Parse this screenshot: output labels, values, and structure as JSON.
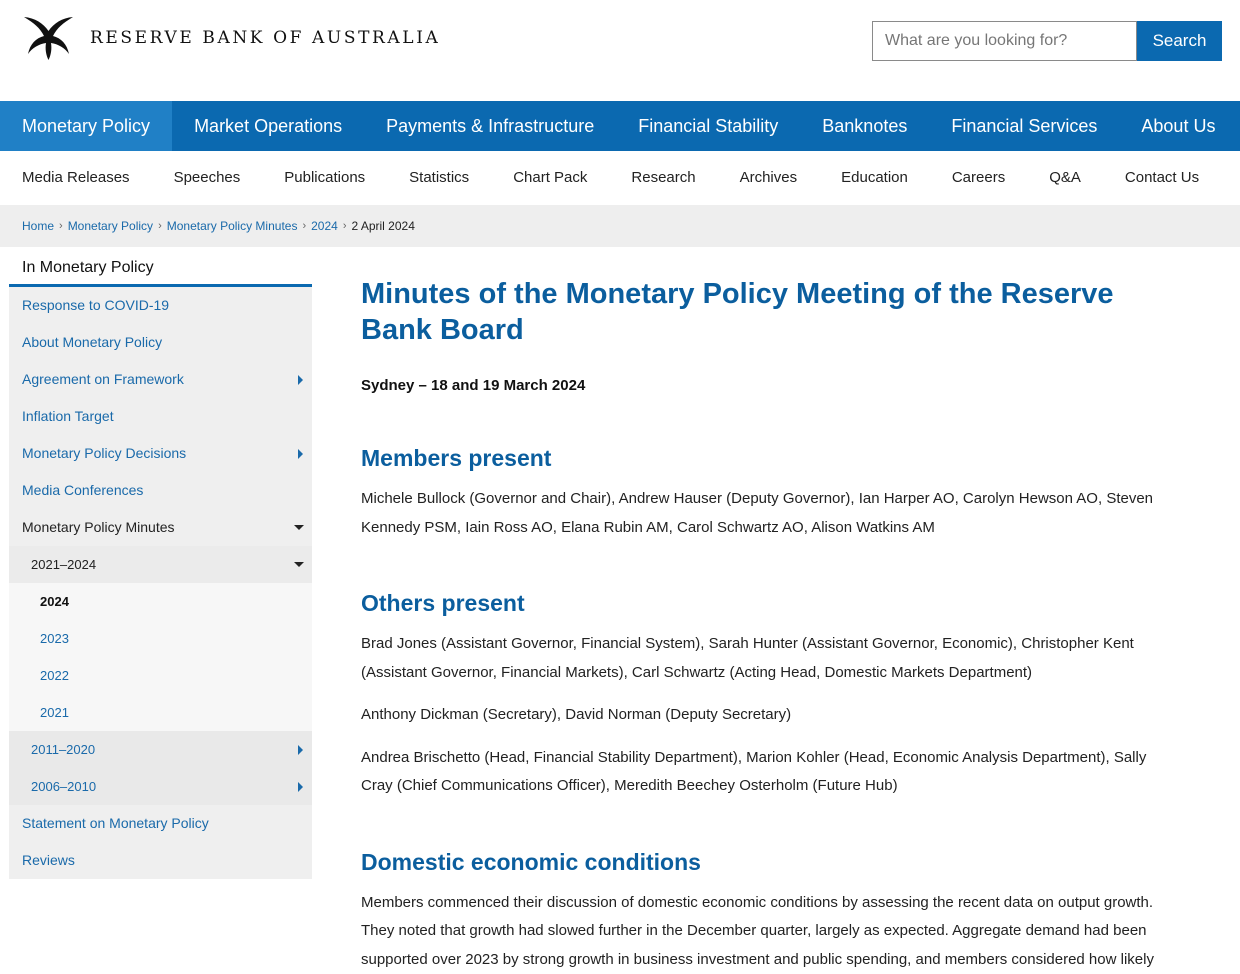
{
  "header": {
    "logo_text": "RESERVE BANK OF AUSTRALIA",
    "search_placeholder": "What are you looking for?",
    "search_button": "Search",
    "brand_color": "#0b69b0"
  },
  "primary_nav": [
    {
      "label": "Monetary Policy",
      "active": true
    },
    {
      "label": "Market Operations"
    },
    {
      "label": "Payments & Infrastructure"
    },
    {
      "label": "Financial Stability"
    },
    {
      "label": "Banknotes"
    },
    {
      "label": "Financial Services"
    },
    {
      "label": "About Us"
    }
  ],
  "secondary_nav": [
    "Media Releases",
    "Speeches",
    "Publications",
    "Statistics",
    "Chart Pack",
    "Research",
    "Archives",
    "Education",
    "Careers",
    "Q&A",
    "Contact Us"
  ],
  "breadcrumb": {
    "links": [
      "Home",
      "Monetary Policy",
      "Monetary Policy Minutes",
      "2024"
    ],
    "current": "2 April 2024"
  },
  "sidebar": {
    "title": "In Monetary Policy",
    "items": [
      "Response to COVID-19",
      "About Monetary Policy",
      "Agreement on Framework",
      "Inflation Target",
      "Monetary Policy Decisions",
      "Media Conferences",
      "Monetary Policy Minutes",
      "2021–2024",
      "2024",
      "2023",
      "2022",
      "2021",
      "2011–2020",
      "2006–2010",
      "Statement on Monetary Policy",
      "Reviews"
    ]
  },
  "main": {
    "title": "Minutes of the Monetary Policy Meeting of the Reserve Bank Board",
    "date": "Sydney – 18 and 19 March 2024",
    "members_heading": "Members present",
    "members_text": "Michele Bullock (Governor and Chair), Andrew Hauser (Deputy Governor), Ian Harper AO, Carolyn Hewson AO, Steven Kennedy PSM, Iain Ross AO, Elana Rubin AM, Carol Schwartz AO, Alison Watkins AM",
    "others_heading": "Others present",
    "others_para1": "Brad Jones (Assistant Governor, Financial System), Sarah Hunter (Assistant Governor, Economic), Christopher Kent (Assistant Governor, Financial Markets), Carl Schwartz (Acting Head, Domestic Markets Department)",
    "others_para2": "Anthony Dickman (Secretary), David Norman (Deputy Secretary)",
    "others_para3": "Andrea Brischetto (Head, Financial Stability Department), Marion Kohler (Head, Economic Analysis Department), Sally Cray (Chief Communications Officer), Meredith Beechey Osterholm (Future Hub)",
    "domestic_heading": "Domestic economic conditions",
    "domestic_text": "Members commenced their discussion of domestic economic conditions by assessing the recent data on output growth. They noted that growth had slowed further in the December quarter, largely as expected. Aggregate demand had been supported over 2023 by strong growth in business investment and public spending, and members considered how likely"
  }
}
